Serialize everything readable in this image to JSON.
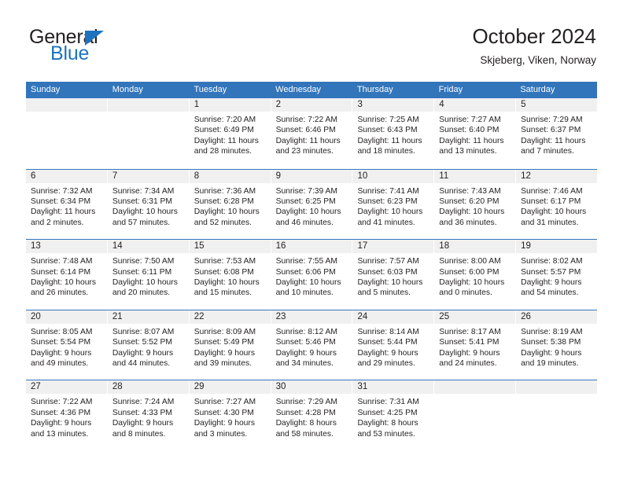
{
  "logo": {
    "word_one": "General",
    "word_two": "Blue",
    "triangle_color": "#1e73be"
  },
  "header": {
    "title": "October 2024",
    "location": "Skjeberg, Viken, Norway"
  },
  "theme": {
    "header_blue": "#3275bb",
    "day_band_gray": "#f0f0f0",
    "text": "#231f20"
  },
  "weekdays": [
    "Sunday",
    "Monday",
    "Tuesday",
    "Wednesday",
    "Thursday",
    "Friday",
    "Saturday"
  ],
  "weeks": [
    [
      {
        "day": "",
        "lines": []
      },
      {
        "day": "",
        "lines": []
      },
      {
        "day": "1",
        "lines": [
          "Sunrise: 7:20 AM",
          "Sunset: 6:49 PM",
          "Daylight: 11 hours",
          "and 28 minutes."
        ]
      },
      {
        "day": "2",
        "lines": [
          "Sunrise: 7:22 AM",
          "Sunset: 6:46 PM",
          "Daylight: 11 hours",
          "and 23 minutes."
        ]
      },
      {
        "day": "3",
        "lines": [
          "Sunrise: 7:25 AM",
          "Sunset: 6:43 PM",
          "Daylight: 11 hours",
          "and 18 minutes."
        ]
      },
      {
        "day": "4",
        "lines": [
          "Sunrise: 7:27 AM",
          "Sunset: 6:40 PM",
          "Daylight: 11 hours",
          "and 13 minutes."
        ]
      },
      {
        "day": "5",
        "lines": [
          "Sunrise: 7:29 AM",
          "Sunset: 6:37 PM",
          "Daylight: 11 hours",
          "and 7 minutes."
        ]
      }
    ],
    [
      {
        "day": "6",
        "lines": [
          "Sunrise: 7:32 AM",
          "Sunset: 6:34 PM",
          "Daylight: 11 hours",
          "and 2 minutes."
        ]
      },
      {
        "day": "7",
        "lines": [
          "Sunrise: 7:34 AM",
          "Sunset: 6:31 PM",
          "Daylight: 10 hours",
          "and 57 minutes."
        ]
      },
      {
        "day": "8",
        "lines": [
          "Sunrise: 7:36 AM",
          "Sunset: 6:28 PM",
          "Daylight: 10 hours",
          "and 52 minutes."
        ]
      },
      {
        "day": "9",
        "lines": [
          "Sunrise: 7:39 AM",
          "Sunset: 6:25 PM",
          "Daylight: 10 hours",
          "and 46 minutes."
        ]
      },
      {
        "day": "10",
        "lines": [
          "Sunrise: 7:41 AM",
          "Sunset: 6:23 PM",
          "Daylight: 10 hours",
          "and 41 minutes."
        ]
      },
      {
        "day": "11",
        "lines": [
          "Sunrise: 7:43 AM",
          "Sunset: 6:20 PM",
          "Daylight: 10 hours",
          "and 36 minutes."
        ]
      },
      {
        "day": "12",
        "lines": [
          "Sunrise: 7:46 AM",
          "Sunset: 6:17 PM",
          "Daylight: 10 hours",
          "and 31 minutes."
        ]
      }
    ],
    [
      {
        "day": "13",
        "lines": [
          "Sunrise: 7:48 AM",
          "Sunset: 6:14 PM",
          "Daylight: 10 hours",
          "and 26 minutes."
        ]
      },
      {
        "day": "14",
        "lines": [
          "Sunrise: 7:50 AM",
          "Sunset: 6:11 PM",
          "Daylight: 10 hours",
          "and 20 minutes."
        ]
      },
      {
        "day": "15",
        "lines": [
          "Sunrise: 7:53 AM",
          "Sunset: 6:08 PM",
          "Daylight: 10 hours",
          "and 15 minutes."
        ]
      },
      {
        "day": "16",
        "lines": [
          "Sunrise: 7:55 AM",
          "Sunset: 6:06 PM",
          "Daylight: 10 hours",
          "and 10 minutes."
        ]
      },
      {
        "day": "17",
        "lines": [
          "Sunrise: 7:57 AM",
          "Sunset: 6:03 PM",
          "Daylight: 10 hours",
          "and 5 minutes."
        ]
      },
      {
        "day": "18",
        "lines": [
          "Sunrise: 8:00 AM",
          "Sunset: 6:00 PM",
          "Daylight: 10 hours",
          "and 0 minutes."
        ]
      },
      {
        "day": "19",
        "lines": [
          "Sunrise: 8:02 AM",
          "Sunset: 5:57 PM",
          "Daylight: 9 hours",
          "and 54 minutes."
        ]
      }
    ],
    [
      {
        "day": "20",
        "lines": [
          "Sunrise: 8:05 AM",
          "Sunset: 5:54 PM",
          "Daylight: 9 hours",
          "and 49 minutes."
        ]
      },
      {
        "day": "21",
        "lines": [
          "Sunrise: 8:07 AM",
          "Sunset: 5:52 PM",
          "Daylight: 9 hours",
          "and 44 minutes."
        ]
      },
      {
        "day": "22",
        "lines": [
          "Sunrise: 8:09 AM",
          "Sunset: 5:49 PM",
          "Daylight: 9 hours",
          "and 39 minutes."
        ]
      },
      {
        "day": "23",
        "lines": [
          "Sunrise: 8:12 AM",
          "Sunset: 5:46 PM",
          "Daylight: 9 hours",
          "and 34 minutes."
        ]
      },
      {
        "day": "24",
        "lines": [
          "Sunrise: 8:14 AM",
          "Sunset: 5:44 PM",
          "Daylight: 9 hours",
          "and 29 minutes."
        ]
      },
      {
        "day": "25",
        "lines": [
          "Sunrise: 8:17 AM",
          "Sunset: 5:41 PM",
          "Daylight: 9 hours",
          "and 24 minutes."
        ]
      },
      {
        "day": "26",
        "lines": [
          "Sunrise: 8:19 AM",
          "Sunset: 5:38 PM",
          "Daylight: 9 hours",
          "and 19 minutes."
        ]
      }
    ],
    [
      {
        "day": "27",
        "lines": [
          "Sunrise: 7:22 AM",
          "Sunset: 4:36 PM",
          "Daylight: 9 hours",
          "and 13 minutes."
        ]
      },
      {
        "day": "28",
        "lines": [
          "Sunrise: 7:24 AM",
          "Sunset: 4:33 PM",
          "Daylight: 9 hours",
          "and 8 minutes."
        ]
      },
      {
        "day": "29",
        "lines": [
          "Sunrise: 7:27 AM",
          "Sunset: 4:30 PM",
          "Daylight: 9 hours",
          "and 3 minutes."
        ]
      },
      {
        "day": "30",
        "lines": [
          "Sunrise: 7:29 AM",
          "Sunset: 4:28 PM",
          "Daylight: 8 hours",
          "and 58 minutes."
        ]
      },
      {
        "day": "31",
        "lines": [
          "Sunrise: 7:31 AM",
          "Sunset: 4:25 PM",
          "Daylight: 8 hours",
          "and 53 minutes."
        ]
      },
      {
        "day": "",
        "lines": []
      },
      {
        "day": "",
        "lines": []
      }
    ]
  ]
}
